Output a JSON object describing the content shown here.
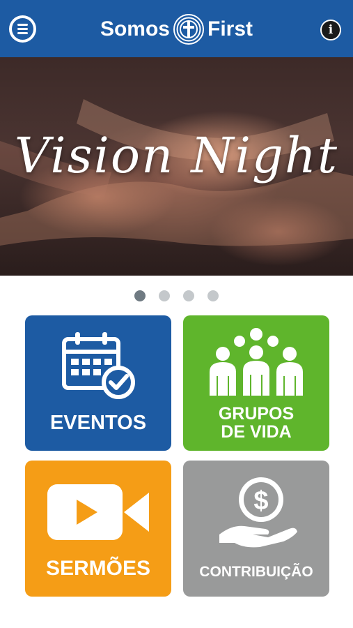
{
  "header": {
    "brand_left": "Somos",
    "brand_right": "First",
    "menu_icon": "hamburger-menu-icon",
    "info_icon": "info-icon",
    "info_glyph": "i",
    "logo_icon": "cross-circle-logo-icon"
  },
  "banner": {
    "text": "Vision Night",
    "slides_total": 4,
    "active_slide": 1
  },
  "tiles": [
    {
      "label": "EVENTOS",
      "icon": "calendar-check-icon",
      "color": "#1d5ba3"
    },
    {
      "label_line1": "GRUPOS",
      "label_line2": "DE VIDA",
      "icon": "group-people-icon",
      "color": "#5fb52c"
    },
    {
      "label": "SERMÕES",
      "icon": "video-camera-icon",
      "color": "#f59d16"
    },
    {
      "label": "CONTRIBUIÇÃO",
      "icon": "hand-dollar-coin-icon",
      "color": "#999a9a"
    }
  ],
  "colors": {
    "header": "#1d5ba3",
    "dot_inactive": "#c4c8cb",
    "dot_active": "#6f7a82"
  }
}
